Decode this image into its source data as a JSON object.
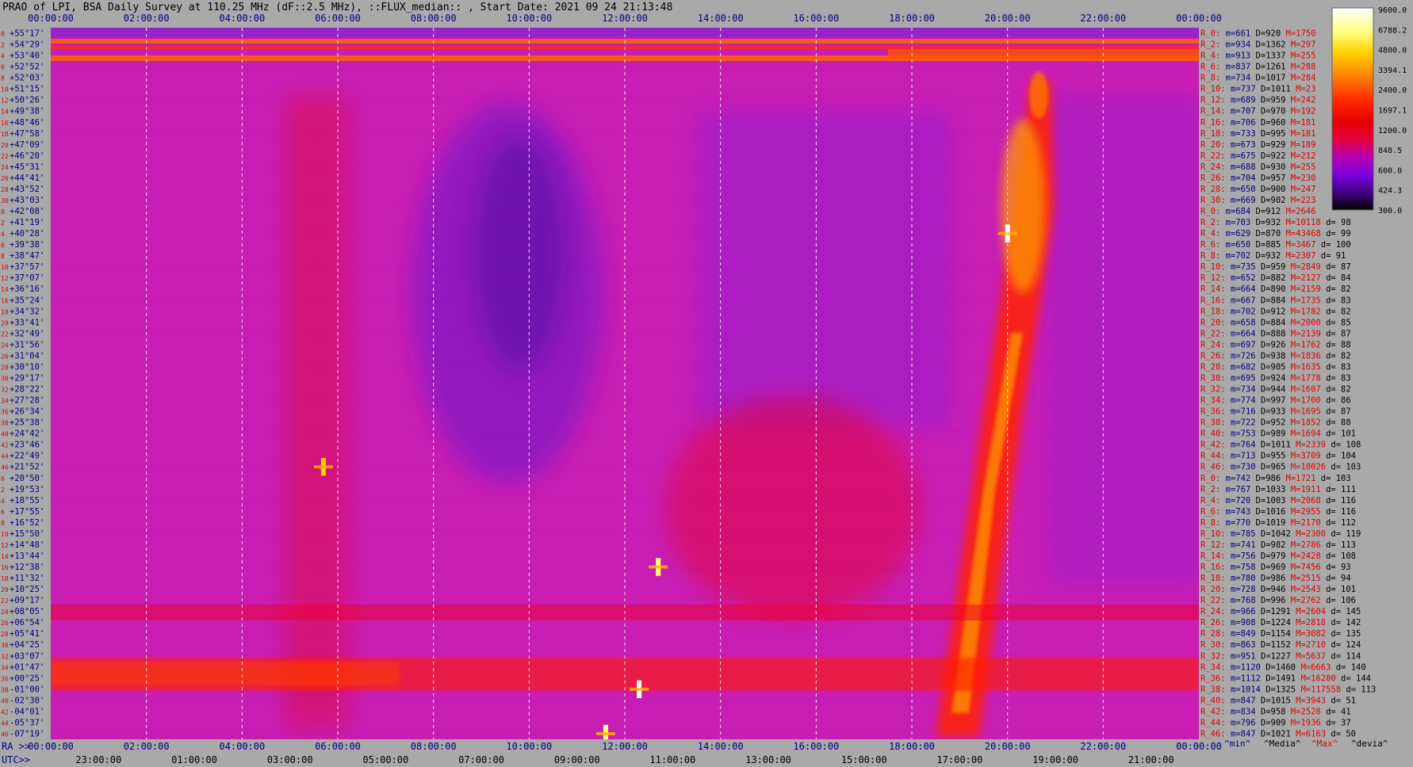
{
  "header": {
    "title": "PRAO of LPI, BSA Daily Survey at 110.25 MHz (dF::2.5 MHz), ::FLUX_median:: , Start Date: 2021 09 24 21:13:48"
  },
  "chart_data": {
    "type": "heatmap",
    "title": "PRAO of LPI, BSA Daily Survey at 110.25 MHz (dF::2.5 MHz), ::FLUX_median:: , Start Date: 2021 09 24 21:13:48",
    "x_top_ticks": [
      "00:00:00",
      "02:00:00",
      "04:00:00",
      "06:00:00",
      "08:00:00",
      "10:00:00",
      "12:00:00",
      "14:00:00",
      "16:00:00",
      "18:00:00",
      "20:00:00",
      "22:00:00",
      "00:00:00"
    ],
    "x_bottom_ra_prefix": "RA >>",
    "x_bottom_ra_ticks": [
      "00:00:00",
      "02:00:00",
      "04:00:00",
      "06:00:00",
      "08:00:00",
      "10:00:00",
      "12:00:00",
      "14:00:00",
      "16:00:00",
      "18:00:00",
      "20:00:00",
      "22:00:00",
      "00:00:00"
    ],
    "x_bottom_utc_prefix": "UTC>>",
    "x_bottom_utc_ticks": [
      "23:00:00",
      "01:00:00",
      "03:00:00",
      "05:00:00",
      "07:00:00",
      "09:00:00",
      "11:00:00",
      "13:00:00",
      "15:00:00",
      "17:00:00",
      "19:00:00",
      "21:00:00"
    ],
    "y_declinations": [
      "+55°17'",
      "+54°29'",
      "+53°40'",
      "+52°52'",
      "+52°03'",
      "+51°15'",
      "+50°26'",
      "+49°38'",
      "+48°46'",
      "+47°58'",
      "+47°09'",
      "+46°20'",
      "+45°31'",
      "+44°41'",
      "+43°52'",
      "+43°03'",
      "+42°08'",
      "+41°19'",
      "+40°28'",
      "+39°38'",
      "+38°47'",
      "+37°57'",
      "+37°07'",
      "+36°16'",
      "+35°24'",
      "+34°32'",
      "+33°41'",
      "+32°49'",
      "+31°56'",
      "+31°04'",
      "+30°10'",
      "+29°17'",
      "+28°22'",
      "+27°28'",
      "+26°34'",
      "+25°38'",
      "+24°42'",
      "+23°46'",
      "+22°49'",
      "+21°52'",
      "+20°50'",
      "+19°53'",
      "+18°55'",
      "+17°55'",
      "+16°52'",
      "+15°50'",
      "+14°48'",
      "+13°44'",
      "+12°38'",
      "+11°32'",
      "+10°25'",
      "+09°17'",
      "+08°05'",
      "+06°54'",
      "+05°41'",
      "+04°25'",
      "+03°07'",
      "+01°47'",
      "+00°25'",
      "-01°00'",
      "-02°30'",
      "-04°01'",
      "-05°37'",
      "-07°19'"
    ],
    "beam_index_labels": [
      "0",
      "2",
      "4",
      "6",
      "8",
      "10",
      "12",
      "14",
      "16",
      "18",
      "20",
      "22",
      "24",
      "26",
      "28",
      "30",
      "0",
      "2",
      "4",
      "6",
      "8",
      "10",
      "12",
      "14",
      "16",
      "18",
      "20",
      "22",
      "24",
      "26",
      "28",
      "30",
      "32",
      "34",
      "36",
      "38",
      "40",
      "42",
      "44",
      "46",
      "0",
      "2",
      "4",
      "6",
      "8",
      "10",
      "12",
      "14",
      "16",
      "18",
      "20",
      "22",
      "24",
      "26",
      "28",
      "30",
      "32",
      "34",
      "36",
      "38",
      "40",
      "42",
      "44",
      "46"
    ],
    "colorbar": {
      "ticks": [
        "9600.0",
        "6788.2",
        "4800.0",
        "3394.1",
        "2400.0",
        "1697.1",
        "1200.0",
        "848.5",
        "600.0",
        "424.3",
        "300.0"
      ],
      "colors": [
        "#ffffff",
        "#ffff80",
        "#ffd200",
        "#ff8000",
        "#ff2800",
        "#e60000",
        "#e6003c",
        "#b400b4",
        "#7800dc",
        "#3c0078",
        "#000000"
      ]
    },
    "stats_rows": [
      {
        "r": "R_0:",
        "m": "m=661",
        "d": "D=920",
        "M": "M=1750",
        "dev": ""
      },
      {
        "r": "R_2:",
        "m": "m=934",
        "d": "D=1362",
        "M": "M=297",
        "dev": ""
      },
      {
        "r": "R_4:",
        "m": "m=913",
        "d": "D=1337",
        "M": "M=255",
        "dev": ""
      },
      {
        "r": "R_6:",
        "m": "m=837",
        "d": "D=1261",
        "M": "M=288",
        "dev": ""
      },
      {
        "r": "R_8:",
        "m": "m=734",
        "d": "D=1017",
        "M": "M=284",
        "dev": ""
      },
      {
        "r": "R_10:",
        "m": "m=737",
        "d": "D=1011",
        "M": "M=23",
        "dev": ""
      },
      {
        "r": "R_12:",
        "m": "m=689",
        "d": "D=959",
        "M": "M=242",
        "dev": ""
      },
      {
        "r": "R_14:",
        "m": "m=707",
        "d": "D=970",
        "M": "M=192",
        "dev": ""
      },
      {
        "r": "R_16:",
        "m": "m=706",
        "d": "D=960",
        "M": "M=181",
        "dev": ""
      },
      {
        "r": "R_18:",
        "m": "m=733",
        "d": "D=995",
        "M": "M=181",
        "dev": ""
      },
      {
        "r": "R_20:",
        "m": "m=673",
        "d": "D=929",
        "M": "M=189",
        "dev": ""
      },
      {
        "r": "R_22:",
        "m": "m=675",
        "d": "D=922",
        "M": "M=212",
        "dev": ""
      },
      {
        "r": "R_24:",
        "m": "m=688",
        "d": "D=930",
        "M": "M=255",
        "dev": ""
      },
      {
        "r": "R_26:",
        "m": "m=704",
        "d": "D=957",
        "M": "M=230",
        "dev": ""
      },
      {
        "r": "R_28:",
        "m": "m=650",
        "d": "D=900",
        "M": "M=247",
        "dev": ""
      },
      {
        "r": "R_30:",
        "m": "m=669",
        "d": "D=902",
        "M": "M=223",
        "dev": ""
      },
      {
        "r": "R_0:",
        "m": "m=684",
        "d": "D=912",
        "M": "M=2646",
        "dev": ""
      },
      {
        "r": "R_2:",
        "m": "m=703",
        "d": "D=932",
        "M": "M=10118",
        "dev": "d= 98"
      },
      {
        "r": "R_4:",
        "m": "m=629",
        "d": "D=870",
        "M": "M=43468",
        "dev": "d= 99"
      },
      {
        "r": "R_6:",
        "m": "m=650",
        "d": "D=885",
        "M": "M=3467",
        "dev": "d= 100"
      },
      {
        "r": "R_8:",
        "m": "m=702",
        "d": "D=932",
        "M": "M=2307",
        "dev": "d= 91"
      },
      {
        "r": "R_10:",
        "m": "m=735",
        "d": "D=959",
        "M": "M=2849",
        "dev": "d= 87"
      },
      {
        "r": "R_12:",
        "m": "m=652",
        "d": "D=882",
        "M": "M=2127",
        "dev": "d= 84"
      },
      {
        "r": "R_14:",
        "m": "m=664",
        "d": "D=890",
        "M": "M=2159",
        "dev": "d= 82"
      },
      {
        "r": "R_16:",
        "m": "m=667",
        "d": "D=884",
        "M": "M=1735",
        "dev": "d= 83"
      },
      {
        "r": "R_18:",
        "m": "m=702",
        "d": "D=912",
        "M": "M=1782",
        "dev": "d= 82"
      },
      {
        "r": "R_20:",
        "m": "m=658",
        "d": "D=884",
        "M": "M=2000",
        "dev": "d= 85"
      },
      {
        "r": "R_22:",
        "m": "m=664",
        "d": "D=888",
        "M": "M=2139",
        "dev": "d= 87"
      },
      {
        "r": "R_24:",
        "m": "m=697",
        "d": "D=926",
        "M": "M=1762",
        "dev": "d= 88"
      },
      {
        "r": "R_26:",
        "m": "m=726",
        "d": "D=938",
        "M": "M=1836",
        "dev": "d= 82"
      },
      {
        "r": "R_28:",
        "m": "m=682",
        "d": "D=905",
        "M": "M=1635",
        "dev": "d= 83"
      },
      {
        "r": "R_30:",
        "m": "m=695",
        "d": "D=924",
        "M": "M=1778",
        "dev": "d= 83"
      },
      {
        "r": "R_32:",
        "m": "m=734",
        "d": "D=944",
        "M": "M=1607",
        "dev": "d= 82"
      },
      {
        "r": "R_34:",
        "m": "m=774",
        "d": "D=997",
        "M": "M=1700",
        "dev": "d= 86"
      },
      {
        "r": "R_36:",
        "m": "m=716",
        "d": "D=933",
        "M": "M=1695",
        "dev": "d= 87"
      },
      {
        "r": "R_38:",
        "m": "m=722",
        "d": "D=952",
        "M": "M=1852",
        "dev": "d= 88"
      },
      {
        "r": "R_40:",
        "m": "m=753",
        "d": "D=989",
        "M": "M=1694",
        "dev": "d= 101"
      },
      {
        "r": "R_42:",
        "m": "m=764",
        "d": "D=1011",
        "M": "M=2339",
        "dev": "d= 108"
      },
      {
        "r": "R_44:",
        "m": "m=713",
        "d": "D=955",
        "M": "M=3709",
        "dev": "d= 104"
      },
      {
        "r": "R_46:",
        "m": "m=730",
        "d": "D=965",
        "M": "M=10026",
        "dev": "d= 103"
      },
      {
        "r": "R_0:",
        "m": "m=742",
        "d": "D=986",
        "M": "M=1721",
        "dev": "d= 103"
      },
      {
        "r": "R_2:",
        "m": "m=767",
        "d": "D=1033",
        "M": "M=1911",
        "dev": "d= 111"
      },
      {
        "r": "R_4:",
        "m": "m=720",
        "d": "D=1003",
        "M": "M=2068",
        "dev": "d= 116"
      },
      {
        "r": "R_6:",
        "m": "m=743",
        "d": "D=1016",
        "M": "M=2955",
        "dev": "d= 116"
      },
      {
        "r": "R_8:",
        "m": "m=770",
        "d": "D=1019",
        "M": "M=2170",
        "dev": "d= 112"
      },
      {
        "r": "R_10:",
        "m": "m=785",
        "d": "D=1042",
        "M": "M=2300",
        "dev": "d= 119"
      },
      {
        "r": "R_12:",
        "m": "m=741",
        "d": "D=982",
        "M": "M=2786",
        "dev": "d= 113"
      },
      {
        "r": "R_14:",
        "m": "m=756",
        "d": "D=979",
        "M": "M=2428",
        "dev": "d= 108"
      },
      {
        "r": "R_16:",
        "m": "m=758",
        "d": "D=969",
        "M": "M=7456",
        "dev": "d= 93"
      },
      {
        "r": "R_18:",
        "m": "m=780",
        "d": "D=986",
        "M": "M=2515",
        "dev": "d= 94"
      },
      {
        "r": "R_20:",
        "m": "m=728",
        "d": "D=946",
        "M": "M=2543",
        "dev": "d= 101"
      },
      {
        "r": "R_22:",
        "m": "m=768",
        "d": "D=996",
        "M": "M=2762",
        "dev": "d= 106"
      },
      {
        "r": "R_24:",
        "m": "m=966",
        "d": "D=1291",
        "M": "M=2604",
        "dev": "d= 145"
      },
      {
        "r": "R_26:",
        "m": "m=908",
        "d": "D=1224",
        "M": "M=2818",
        "dev": "d= 142"
      },
      {
        "r": "R_28:",
        "m": "m=849",
        "d": "D=1154",
        "M": "M=3082",
        "dev": "d= 135"
      },
      {
        "r": "R_30:",
        "m": "m=863",
        "d": "D=1152",
        "M": "M=2710",
        "dev": "d= 124"
      },
      {
        "r": "R_32:",
        "m": "m=951",
        "d": "D=1227",
        "M": "M=5637",
        "dev": "d= 114"
      },
      {
        "r": "R_34:",
        "m": "m=1120",
        "d": "D=1460",
        "M": "M=6663",
        "dev": "d= 140"
      },
      {
        "r": "R_36:",
        "m": "m=1112",
        "d": "D=1491",
        "M": "M=16280",
        "dev": "d= 144"
      },
      {
        "r": "R_38:",
        "m": "m=1014",
        "d": "D=1325",
        "M": "M=117558",
        "dev": "d= 113"
      },
      {
        "r": "R_40:",
        "m": "m=847",
        "d": "D=1015",
        "M": "M=3943",
        "dev": "d= 51"
      },
      {
        "r": "R_42:",
        "m": "m=834",
        "d": "D=958",
        "M": "M=2528",
        "dev": "d= 41"
      },
      {
        "r": "R_44:",
        "m": "m=796",
        "d": "D=909",
        "M": "M=1936",
        "dev": "d= 37"
      },
      {
        "r": "R_46:",
        "m": "m=847",
        "d": "D=1021",
        "M": "M=6163",
        "dev": "d= 50"
      }
    ],
    "legend_footer": [
      "^min^",
      "^Media^",
      "^Max^",
      "^devia^"
    ],
    "features": [
      {
        "ra_hours": 20.0,
        "row": 18,
        "value": 9600
      },
      {
        "ra_hours": 12.3,
        "row": 59,
        "value": 9600
      },
      {
        "ra_hours": 12.7,
        "row": 48,
        "value": 6788.2
      },
      {
        "ra_hours": 5.7,
        "row": 39,
        "value": 4800.0
      },
      {
        "ra_hours": 11.6,
        "row": 63,
        "value": 6788.2
      }
    ]
  },
  "colors": {
    "background": "#a9a9a9",
    "label_blue": "#000080",
    "label_red": "#e00000",
    "label_black": "#000000"
  }
}
